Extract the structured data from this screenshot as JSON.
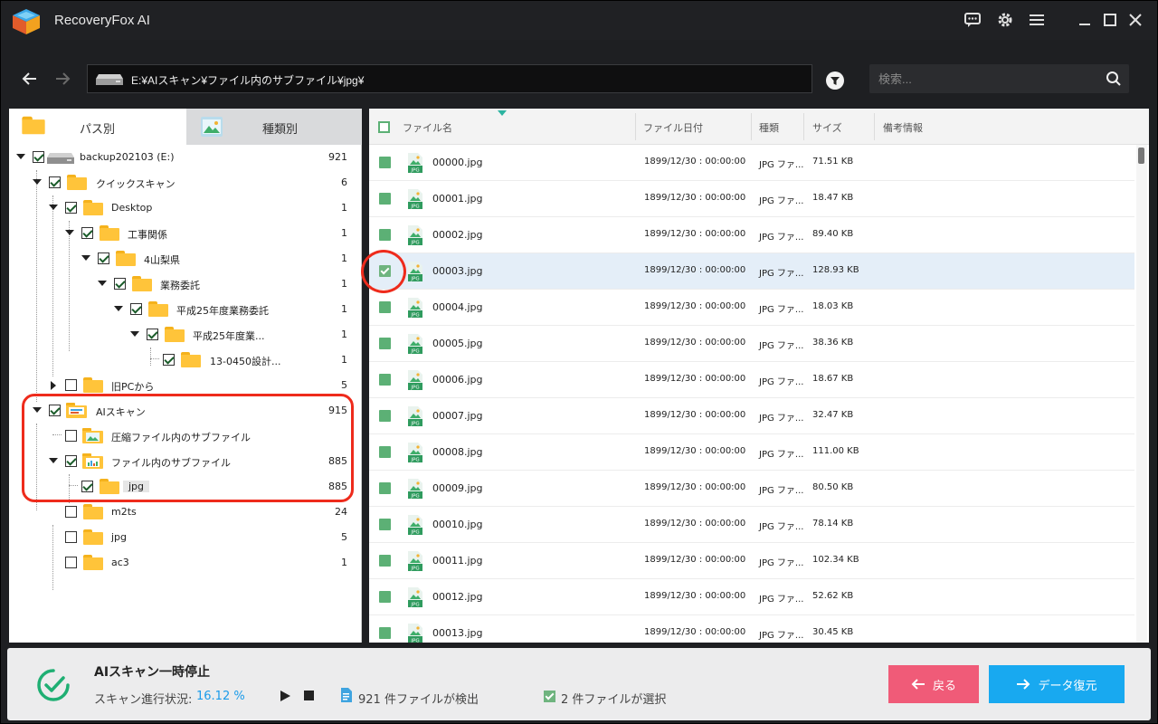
{
  "app": {
    "title": "RecoveryFox AI"
  },
  "titlebar": {
    "icons": [
      "chat-icon",
      "gear-icon",
      "menu-icon",
      "minimize-icon",
      "maximize-icon",
      "close-icon"
    ]
  },
  "pathbar": {
    "path": "E:¥AIスキャン¥ファイル内のサブファイル¥jpg¥",
    "search_placeholder": "検索..."
  },
  "left_tabs": {
    "path_tab": "パス別",
    "type_tab": "種類別"
  },
  "tree": [
    {
      "label": "backup202103 (E:)",
      "count": "921",
      "checked": true,
      "arrow": "down",
      "icon": "drive"
    },
    {
      "label": "クイックスキャン",
      "count": "6",
      "checked": true,
      "arrow": "down",
      "icon": "folder"
    },
    {
      "label": "Desktop",
      "count": "1",
      "checked": true,
      "arrow": "down",
      "icon": "folder"
    },
    {
      "label": "工事関係",
      "count": "1",
      "checked": true,
      "arrow": "down",
      "icon": "folder"
    },
    {
      "label": "4山梨県",
      "count": "1",
      "checked": true,
      "arrow": "down",
      "icon": "folder"
    },
    {
      "label": "業務委託",
      "count": "1",
      "checked": true,
      "arrow": "down",
      "icon": "folder"
    },
    {
      "label": "平成25年度業務委託",
      "count": "1",
      "checked": true,
      "arrow": "down",
      "icon": "folder"
    },
    {
      "label": "平成25年度業...",
      "count": "1",
      "checked": true,
      "arrow": "down",
      "icon": "folder"
    },
    {
      "label": "13-0450設計...",
      "count": "1",
      "checked": true,
      "arrow": "none",
      "icon": "folder"
    },
    {
      "label": "旧PCから",
      "count": "5",
      "checked": false,
      "arrow": "right",
      "icon": "folder"
    },
    {
      "label": "AIスキャン",
      "count": "915",
      "checked": true,
      "arrow": "down",
      "icon": "ai-folder"
    },
    {
      "label": "圧縮ファイル内のサブファイル",
      "count": "",
      "checked": false,
      "arrow": "none",
      "icon": "image-folder"
    },
    {
      "label": "ファイル内のサブファイル",
      "count": "885",
      "checked": true,
      "arrow": "down",
      "icon": "chart-folder"
    },
    {
      "label": "jpg",
      "count": "885",
      "checked": true,
      "arrow": "none",
      "icon": "folder",
      "selected": true
    },
    {
      "label": "m2ts",
      "count": "24",
      "checked": false,
      "arrow": "none",
      "icon": "folder"
    },
    {
      "label": "jpg",
      "count": "5",
      "checked": false,
      "arrow": "none",
      "icon": "folder"
    },
    {
      "label": "ac3",
      "count": "1",
      "checked": false,
      "arrow": "none",
      "icon": "folder"
    }
  ],
  "table": {
    "columns": [
      "ファイル名",
      "ファイル日付",
      "種類",
      "サイズ",
      "備考情報"
    ],
    "rows": [
      {
        "name": "00000.jpg",
        "date": "1899/12/30 : 00:00:00",
        "type": "JPG ファ...",
        "size": "71.51 KB"
      },
      {
        "name": "00001.jpg",
        "date": "1899/12/30 : 00:00:00",
        "type": "JPG ファ...",
        "size": "18.47 KB"
      },
      {
        "name": "00002.jpg",
        "date": "1899/12/30 : 00:00:00",
        "type": "JPG ファ...",
        "size": "89.40 KB"
      },
      {
        "name": "00003.jpg",
        "date": "1899/12/30 : 00:00:00",
        "type": "JPG ファ...",
        "size": "128.93 KB",
        "selected": true
      },
      {
        "name": "00004.jpg",
        "date": "1899/12/30 : 00:00:00",
        "type": "JPG ファ...",
        "size": "18.03 KB"
      },
      {
        "name": "00005.jpg",
        "date": "1899/12/30 : 00:00:00",
        "type": "JPG ファ...",
        "size": "38.36 KB"
      },
      {
        "name": "00006.jpg",
        "date": "1899/12/30 : 00:00:00",
        "type": "JPG ファ...",
        "size": "18.67 KB"
      },
      {
        "name": "00007.jpg",
        "date": "1899/12/30 : 00:00:00",
        "type": "JPG ファ...",
        "size": "32.47 KB"
      },
      {
        "name": "00008.jpg",
        "date": "1899/12/30 : 00:00:00",
        "type": "JPG ファ...",
        "size": "111.00 KB"
      },
      {
        "name": "00009.jpg",
        "date": "1899/12/30 : 00:00:00",
        "type": "JPG ファ...",
        "size": "80.50 KB"
      },
      {
        "name": "00010.jpg",
        "date": "1899/12/30 : 00:00:00",
        "type": "JPG ファ...",
        "size": "78.14 KB"
      },
      {
        "name": "00011.jpg",
        "date": "1899/12/30 : 00:00:00",
        "type": "JPG ファ...",
        "size": "102.34 KB"
      },
      {
        "name": "00012.jpg",
        "date": "1899/12/30 : 00:00:00",
        "type": "JPG ファ...",
        "size": "52.62 KB"
      },
      {
        "name": "00013.jpg",
        "date": "1899/12/30 : 00:00:00",
        "type": "JPG ファ...",
        "size": "30.45 KB"
      }
    ]
  },
  "status": {
    "title": "AIスキャン一時停止",
    "progress_label": "スキャン進行状況:",
    "progress_value": "16.12 %",
    "found_count": "921",
    "found_text": "件ファイルが検出",
    "selected_count": "2",
    "selected_text": "件ファイルが選択"
  },
  "buttons": {
    "back": "戻る",
    "recover": "データ復元"
  },
  "colors": {
    "accent_blue": "#18a9f0",
    "back_pink": "#f05b78",
    "highlight_red": "#ee2b1c",
    "check_green": "#5cb075",
    "folder_yellow": "#ffc43a"
  }
}
